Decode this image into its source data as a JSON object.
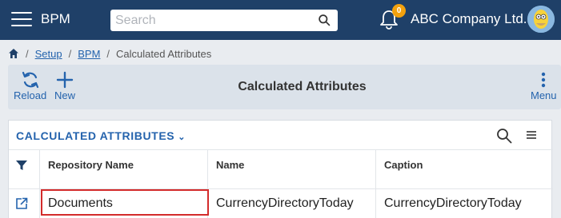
{
  "header": {
    "app_title": "BPM",
    "search_placeholder": "Search",
    "notification_count": "0",
    "company_name": "ABC Company Ltd."
  },
  "breadcrumb": {
    "items": [
      "Setup",
      "BPM"
    ],
    "current": "Calculated Attributes"
  },
  "toolbar": {
    "reload_label": "Reload",
    "new_label": "New",
    "title": "Calculated Attributes",
    "menu_label": "Menu"
  },
  "panel": {
    "title": "CALCULATED ATTRIBUTES",
    "columns": [
      "Repository Name",
      "Name",
      "Caption"
    ],
    "rows": [
      {
        "repository_name": "Documents",
        "name": "CurrencyDirectoryToday",
        "caption": "CurrencyDirectoryToday"
      }
    ]
  },
  "colors": {
    "header_bg": "#1f4068",
    "accent": "#2463ad",
    "badge": "#f3a10d",
    "highlight": "#d32b2b"
  },
  "icons": [
    "hamburger-icon",
    "search-icon",
    "bell-icon",
    "avatar",
    "home-icon",
    "reload-icon",
    "plus-icon",
    "kebab-menu-icon",
    "chevron-down-icon",
    "list-menu-icon",
    "filter-icon",
    "open-external-icon"
  ]
}
